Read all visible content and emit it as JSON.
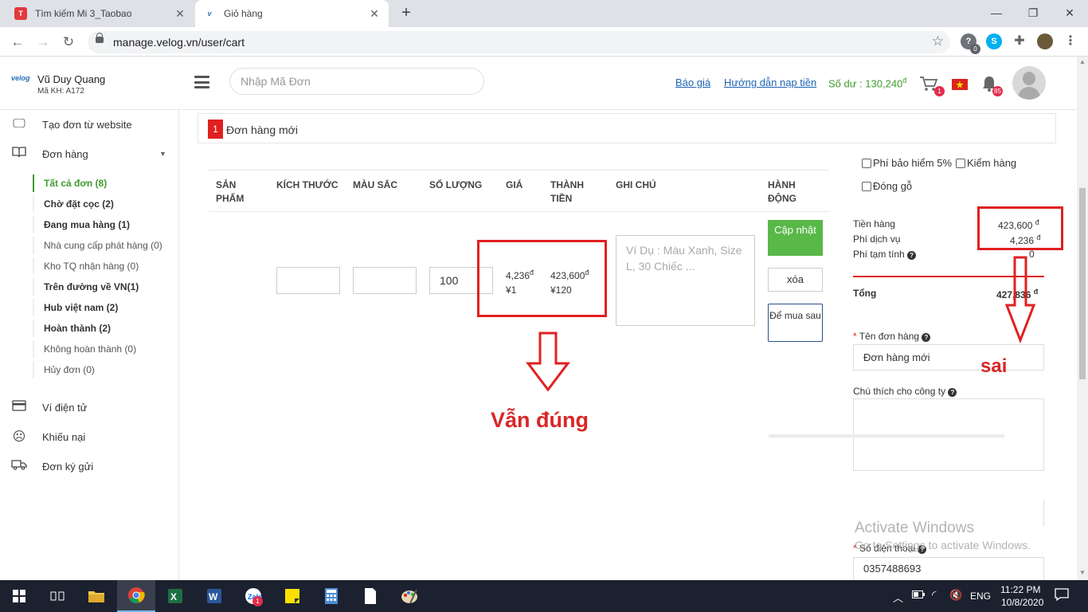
{
  "browser": {
    "tabs": [
      {
        "title": "Tìm kiếm Mi 3_Taobao",
        "favicon": "taobao-icon"
      },
      {
        "title": "Giỏ hàng",
        "favicon": "velog-icon"
      }
    ],
    "url": "manage.velog.vn/user/cart",
    "extension_badge": "0"
  },
  "header": {
    "logo": "velog",
    "user_name": "Vũ Duy Quang",
    "user_code": "Mã KH: A172",
    "search_placeholder": "Nhập Mã Đơn",
    "link_quote": "Báo giá",
    "link_topup": "Hướng dẫn nạp tiền",
    "balance": "Số dư : 130,240",
    "currency": "đ",
    "cart_badge": "1",
    "notif_badge": "85"
  },
  "sidebar": {
    "create_order": "Tạo đơn từ website",
    "orders": "Đơn hàng",
    "sub": [
      "Tất cả đơn (8)",
      "Chờ đặt cọc (2)",
      "Đang mua hàng (1)",
      "Nhà cung cấp phát hàng (0)",
      "Kho TQ nhận hàng (0)",
      "Trên đường về VN(1)",
      "Hub việt nam (2)",
      "Hoàn thành (2)",
      "Không hoàn thành (0)",
      "Hủy đơn (0)"
    ],
    "wallet": "Ví điện tử",
    "complaint": "Khiếu nại",
    "consign": "Đơn ký gửi"
  },
  "order": {
    "number": "1",
    "title": "Đơn hàng mới",
    "columns": [
      "SẢN PHẨM",
      "KÍCH THƯỚC",
      "MÀU SẮC",
      "SỐ LƯỢNG",
      "GIÁ",
      "THÀNH TIỀN",
      "GHI CHÚ",
      "HÀNH ĐỘNG"
    ],
    "quantity": "100",
    "price_vnd": "4,236",
    "price_cny": "¥1",
    "total_vnd": "423,600",
    "total_cny": "¥120",
    "note_placeholder": "Ví Dụ : Màu Xanh, Size L, 30 Chiếc ...",
    "btn_update": "Cập nhật",
    "btn_delete": "xóa",
    "btn_later": "Để mua sau"
  },
  "summary": {
    "insurance": "Phí bảo hiểm 5%",
    "inspection": "Kiểm hàng",
    "wood": "Đóng gỗ",
    "goods_label": "Tiền hàng",
    "goods_value": "423,600",
    "service_label": "Phí dịch vụ",
    "service_value": "4,236",
    "temp_label": "Phí tạm tính",
    "temp_value": "0",
    "total_label": "Tổng",
    "total_value": "427,836",
    "order_name_label": "Tên đơn hàng",
    "order_name_value": "Đơn hàng mới",
    "company_note_label": "Chú thích cho công ty",
    "phone_label": "Số điện thoại",
    "phone_value": "0357488693"
  },
  "annotations": {
    "correct": "Vẫn đúng",
    "wrong": "sai",
    "color": "#e02020"
  },
  "watermark": {
    "title": "Activate Windows",
    "subtitle": "Go to Settings to activate Windows."
  },
  "taskbar": {
    "lang": "ENG",
    "time": "11:22 PM",
    "date": "10/8/2020",
    "zalo_badge": "1"
  }
}
